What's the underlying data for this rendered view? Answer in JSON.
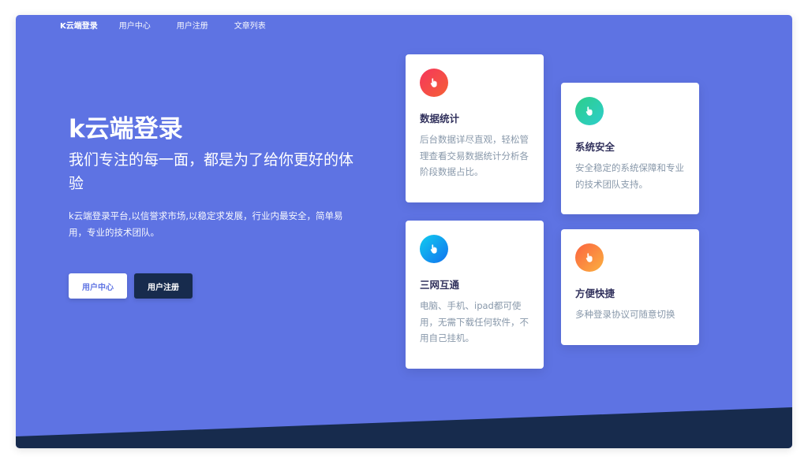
{
  "nav": {
    "brand": "K云端登录",
    "links": [
      "用户中心",
      "用户注册",
      "文章列表"
    ]
  },
  "hero": {
    "title": "k云端登录",
    "subtitle": "我们专注的每一面，都是为了给你更好的体验",
    "description": "k云端登录平台,以信誉求市场,以稳定求发展，行业内最安全，简单易用，专业的技术团队。",
    "primary_button": "用户中心",
    "secondary_button": "用户注册"
  },
  "cards": [
    {
      "icon": "thumb-pointer-icon",
      "title": "数据统计",
      "text": "后台数据详尽直观，轻松管理查看交易数据统计分析各阶段数据占比。"
    },
    {
      "icon": "thumb-pointer-icon",
      "title": "系统安全",
      "text": "安全稳定的系统保障和专业的技术团队支持。"
    },
    {
      "icon": "thumb-pointer-icon",
      "title": "三网互通",
      "text": "电脑、手机、ipad都可使用，无需下载任何软件，不用自己挂机。"
    },
    {
      "icon": "thumb-pointer-icon",
      "title": "方便快捷",
      "text": "多种登录协议可随意切换"
    }
  ],
  "colors": {
    "hero_bg": "#5e73e3",
    "dark": "#172b4d",
    "card_title": "#32325d",
    "card_text": "#8898aa",
    "icon_red": "#f5365c",
    "icon_green": "#2dce89",
    "icon_blue": "#11cdef",
    "icon_orange": "#fb6340"
  }
}
